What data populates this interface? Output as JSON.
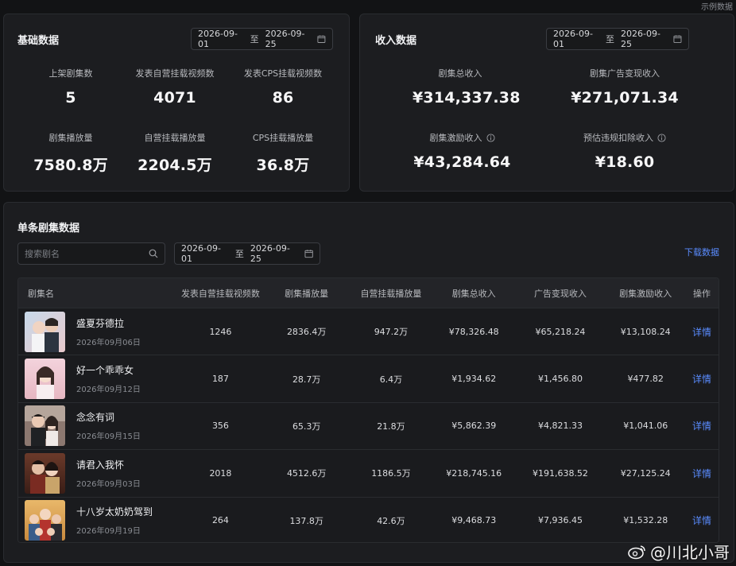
{
  "sample_tag": "示例数据",
  "basic": {
    "title": "基础数据",
    "date_start": "2026-09-01",
    "date_sep": "至",
    "date_end": "2026-09-25",
    "stats": [
      {
        "label": "上架剧集数",
        "value": "5"
      },
      {
        "label": "发表自营挂载视频数",
        "value": "4071"
      },
      {
        "label": "发表CPS挂载视频数",
        "value": "86"
      },
      {
        "label": "剧集播放量",
        "value": "7580.8万"
      },
      {
        "label": "自营挂载播放量",
        "value": "2204.5万"
      },
      {
        "label": "CPS挂载播放量",
        "value": "36.8万"
      }
    ]
  },
  "income": {
    "title": "收入数据",
    "date_start": "2026-09-01",
    "date_sep": "至",
    "date_end": "2026-09-25",
    "stats": [
      {
        "label": "剧集总收入",
        "value": "¥314,337.38"
      },
      {
        "label": "剧集广告变现收入",
        "value": "¥271,071.34"
      },
      {
        "label": "剧集激励收入",
        "value": "¥43,284.64"
      },
      {
        "label": "预估违规扣除收入",
        "value": "¥18.60"
      }
    ]
  },
  "single": {
    "title": "单条剧集数据",
    "search_placeholder": "搜索剧名",
    "date_start": "2026-09-01",
    "date_sep": "至",
    "date_end": "2026-09-25",
    "download_label": "下载数据",
    "columns": [
      "剧集名",
      "发表自营挂载视频数",
      "剧集播放量",
      "自营挂载播放量",
      "剧集总收入",
      "广告变现收入",
      "剧集激励收入",
      "操作"
    ],
    "rows": [
      {
        "name": "盛夏芬德拉",
        "date": "2026年09月06日",
        "videos": "1246",
        "plays": "2836.4万",
        "self_plays": "947.2万",
        "total": "¥78,326.48",
        "ad": "¥65,218.24",
        "incentive": "¥13,108.24",
        "action": "详情"
      },
      {
        "name": "好一个乖乖女",
        "date": "2026年09月12日",
        "videos": "187",
        "plays": "28.7万",
        "self_plays": "6.4万",
        "total": "¥1,934.62",
        "ad": "¥1,456.80",
        "incentive": "¥477.82",
        "action": "详情"
      },
      {
        "name": "念念有词",
        "date": "2026年09月15日",
        "videos": "356",
        "plays": "65.3万",
        "self_plays": "21.8万",
        "total": "¥5,862.39",
        "ad": "¥4,821.33",
        "incentive": "¥1,041.06",
        "action": "详情"
      },
      {
        "name": "请君入我怀",
        "date": "2026年09月03日",
        "videos": "2018",
        "plays": "4512.6万",
        "self_plays": "1186.5万",
        "total": "¥218,745.16",
        "ad": "¥191,638.52",
        "incentive": "¥27,125.24",
        "action": "详情"
      },
      {
        "name": "十八岁太奶奶驾到",
        "date": "2026年09月19日",
        "videos": "264",
        "plays": "137.8万",
        "self_plays": "42.6万",
        "total": "¥9,468.73",
        "ad": "¥7,936.45",
        "incentive": "¥1,532.28",
        "action": "详情"
      }
    ]
  },
  "watermark": "@川北小哥",
  "colors": {
    "accent": "#5a8cff",
    "card": "#1c1d20",
    "background": "#121315"
  }
}
